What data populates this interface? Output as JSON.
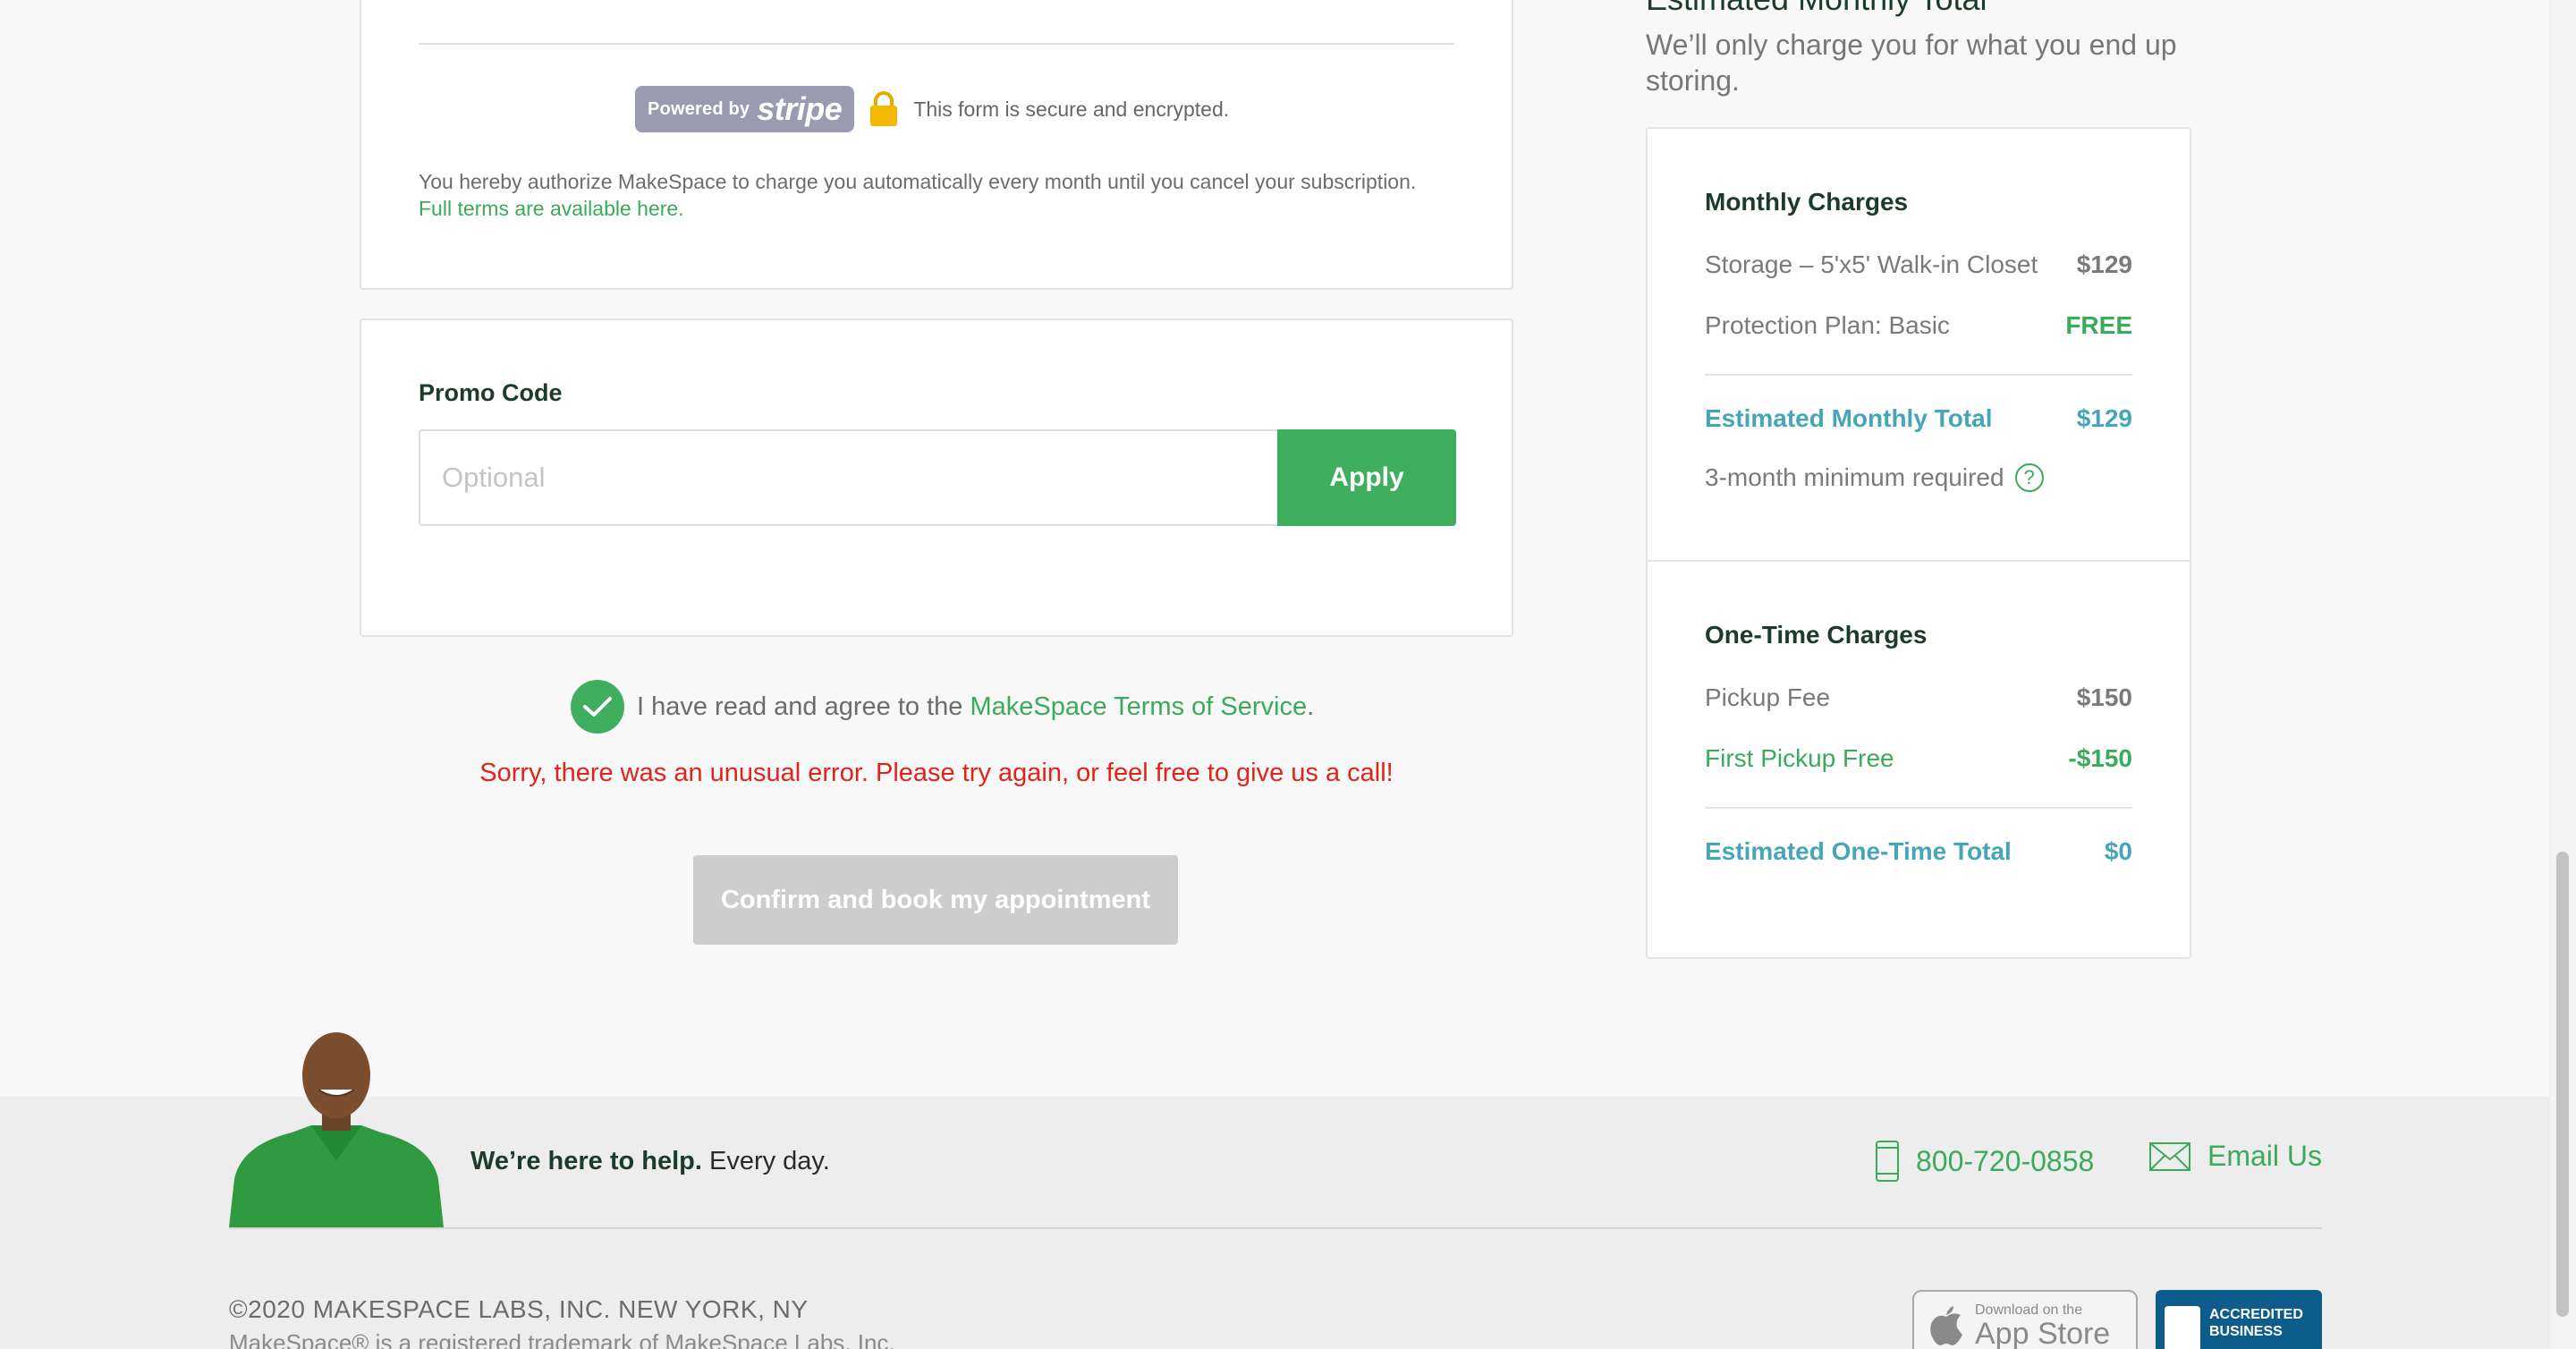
{
  "payment": {
    "stripe_powered": "Powered by",
    "stripe_word": "stripe",
    "secure_text": "This form is secure and encrypted.",
    "authorize_text": "You hereby authorize MakeSpace to charge you automatically every month until you cancel your subscription.",
    "terms_link": "Full terms are available here."
  },
  "promo": {
    "label": "Promo Code",
    "placeholder": "Optional",
    "apply_label": "Apply"
  },
  "agreement": {
    "text_prefix": "I have read and agree to the",
    "tos_link": "MakeSpace Terms of Service",
    "text_suffix": ".",
    "checked": true
  },
  "error_message": "Sorry, there was an unusual error. Please try again, or feel free to give us a call!",
  "confirm_label": "Confirm and book my appointment",
  "summary": {
    "heading": "Estimated Monthly Total",
    "subheading": "We’ll only charge you for what you end up storing.",
    "monthly": {
      "title": "Monthly Charges",
      "rows": [
        {
          "label": "Storage – 5'x5' Walk-in Closet",
          "value": "$129"
        },
        {
          "label": "Protection Plan: Basic",
          "value": "FREE"
        }
      ],
      "total_label": "Estimated Monthly Total",
      "total_value": "$129",
      "minimum_note": "3-month minimum required",
      "help_glyph": "?"
    },
    "one_time": {
      "title": "One-Time Charges",
      "rows": [
        {
          "label": "Pickup Fee",
          "value": "$150"
        },
        {
          "label": "First Pickup Free",
          "value": "-$150"
        }
      ],
      "total_label": "Estimated One-Time Total",
      "total_value": "$0"
    }
  },
  "footer": {
    "help_bold": "We’re here to help.",
    "help_rest": " Every day.",
    "phone": "800-720-0858",
    "email_label": "Email Us",
    "copyright": "©2020 MAKESPACE LABS, INC. NEW YORK, NY",
    "trademark": "MakeSpace® is a registered trademark of MakeSpace Labs, Inc.",
    "appstore_small": "Download on the",
    "appstore_big": "App Store",
    "bbb_line1": "ACCREDITED",
    "bbb_line2": "BUSINESS"
  },
  "colors": {
    "brand_green": "#3fae5f",
    "error_red": "#e2231a",
    "total_blue": "#46a6b8",
    "disabled_gray": "#cdcdcd"
  },
  "icons": [
    "lock-icon",
    "check-icon",
    "help-icon",
    "phone-icon",
    "mail-icon",
    "apple-icon"
  ]
}
